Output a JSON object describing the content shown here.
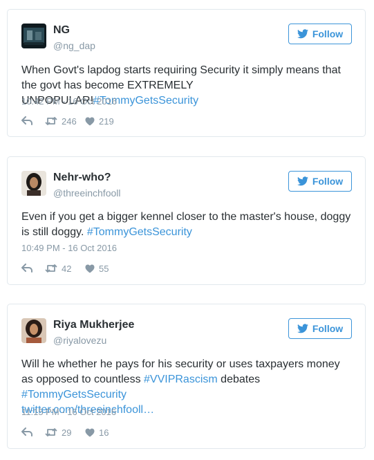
{
  "colors": {
    "accent": "#3b94d9",
    "muted": "#8899a6",
    "text": "#292f33",
    "border": "#e1e8ed"
  },
  "follow_label": "Follow",
  "tweets": [
    {
      "name": "NG",
      "handle": "@ng_dap",
      "text_plain": "When Govt's lapdog starts requiring Security it simply means that the govt has become EXTREMELY UNPOPULAR!",
      "hashtag1": "#TommyGetsSecurity",
      "timestamp": "10:42 PM - 16 Oct 2016",
      "retweets": "246",
      "likes": "219"
    },
    {
      "name": "Nehr-who?",
      "handle": "@threeinchfooll",
      "text_plain": "Even if you get a bigger kennel closer to the master's house, doggy is still doggy.",
      "hashtag1": "#TommyGetsSecurity",
      "timestamp": "10:49 PM - 16 Oct 2016",
      "retweets": "42",
      "likes": "55"
    },
    {
      "name": "Riya Mukherjee",
      "handle": "@riyalovezu",
      "text_plain": "Will he whether he pays for his security or uses taxpayers money as opposed to countless",
      "hashtag1": "#VVIPRascism",
      "text_mid": "debates",
      "hashtag2": "#TommyGetsSecurity",
      "link": "twitter.com/threeinchfooll…",
      "timestamp": "11:15 PM - 16 Oct 2016",
      "retweets": "29",
      "likes": "16"
    }
  ]
}
